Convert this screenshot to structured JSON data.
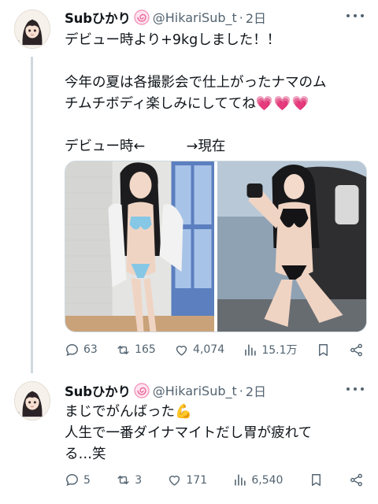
{
  "tweets": [
    {
      "name": "Subひかり",
      "badge_icon": "pink-lollipop-badge",
      "handle": "@HikariSub_t",
      "separator": "·",
      "time": "2日",
      "lines": [
        "デビュー時より+9kgしました！！",
        "",
        "今年の夏は各撮影会で仕上がったナマのム",
        "チムチボディ楽しみにしててね",
        "",
        "デビュー時←　　　→現在"
      ],
      "hearts": "💗💗💗",
      "media": [
        {
          "alt": "photo-before-light-blue-swimsuit"
        },
        {
          "alt": "photo-now-black-swimsuit"
        }
      ],
      "stats": {
        "replies": "63",
        "retweets": "165",
        "likes": "4,074",
        "views": "15.1万"
      }
    },
    {
      "name": "Subひかり",
      "badge_icon": "pink-lollipop-badge",
      "handle": "@HikariSub_t",
      "separator": "·",
      "time": "2日",
      "lines": [
        "まじでがんばった💪",
        "人生で一番ダイナマイトだし胃が疲れて",
        "る…笑"
      ],
      "stats": {
        "replies": "5",
        "retweets": "3",
        "likes": "171",
        "views": "6,540"
      }
    }
  ],
  "colors": {
    "text": "#0f1419",
    "muted": "#536471",
    "border": "#cfd9de",
    "heart": "#e91e8c"
  }
}
